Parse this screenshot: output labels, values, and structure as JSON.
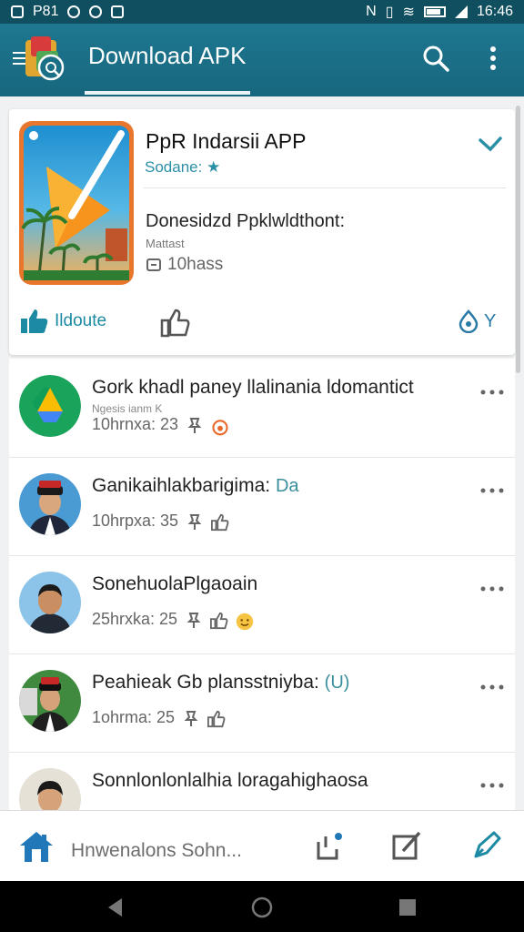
{
  "status_bar": {
    "left_text": "P81",
    "time": "16:46",
    "icons": [
      "notification-icon",
      "spotify-icon",
      "messenger-icon",
      "photo-icon",
      "nfc-icon",
      "vibrate-icon",
      "wifi-icon",
      "battery-icon",
      "signal-icon"
    ]
  },
  "app_bar": {
    "title": "Download APK",
    "actions": [
      "search-icon",
      "more-vert-icon"
    ]
  },
  "app_card": {
    "name": "PpR Indarsii APP",
    "subtitle": "Sodane:",
    "subtitle_icon": "star-icon",
    "download_title": "Donesidzd Ppklwldthont:",
    "meta": "Mattast",
    "size": "10hass",
    "like_label": "Ildoute",
    "right_label": "Y"
  },
  "list": [
    {
      "title": "Gork khadl paney llalinania ldomantict",
      "sub": "Ngesis ianm K",
      "meta": "10hrnxa: 23",
      "avatar": "drive-logo",
      "badge": ""
    },
    {
      "title": "Ganikaihlakbarigima:",
      "sub": "",
      "meta": "10hrpxa: 35",
      "avatar": "man-red-cap",
      "badge": "Da"
    },
    {
      "title": "SonehuolaPlgaoain",
      "sub": "",
      "meta": "25hrxka: 25",
      "avatar": "man-plain",
      "badge": ""
    },
    {
      "title": "Peahieak Gb plansstniyba:",
      "sub": "",
      "meta": "1ohrma: 25",
      "avatar": "man-red-cap-2",
      "badge": "(U)"
    },
    {
      "title": "Sonnlonlonlalhia loragahighaosa",
      "sub": "",
      "meta": "",
      "avatar": "man-plain-2",
      "badge": ""
    }
  ],
  "bottom_bar": {
    "text": "Hnwenalons Sohn...",
    "icons": [
      "home-icon",
      "share-icon",
      "edit-icon",
      "pen-icon"
    ]
  },
  "colors": {
    "appbar": "#1b6f86",
    "accent": "#2b8fa5",
    "statusbar": "#0f4f5f"
  }
}
